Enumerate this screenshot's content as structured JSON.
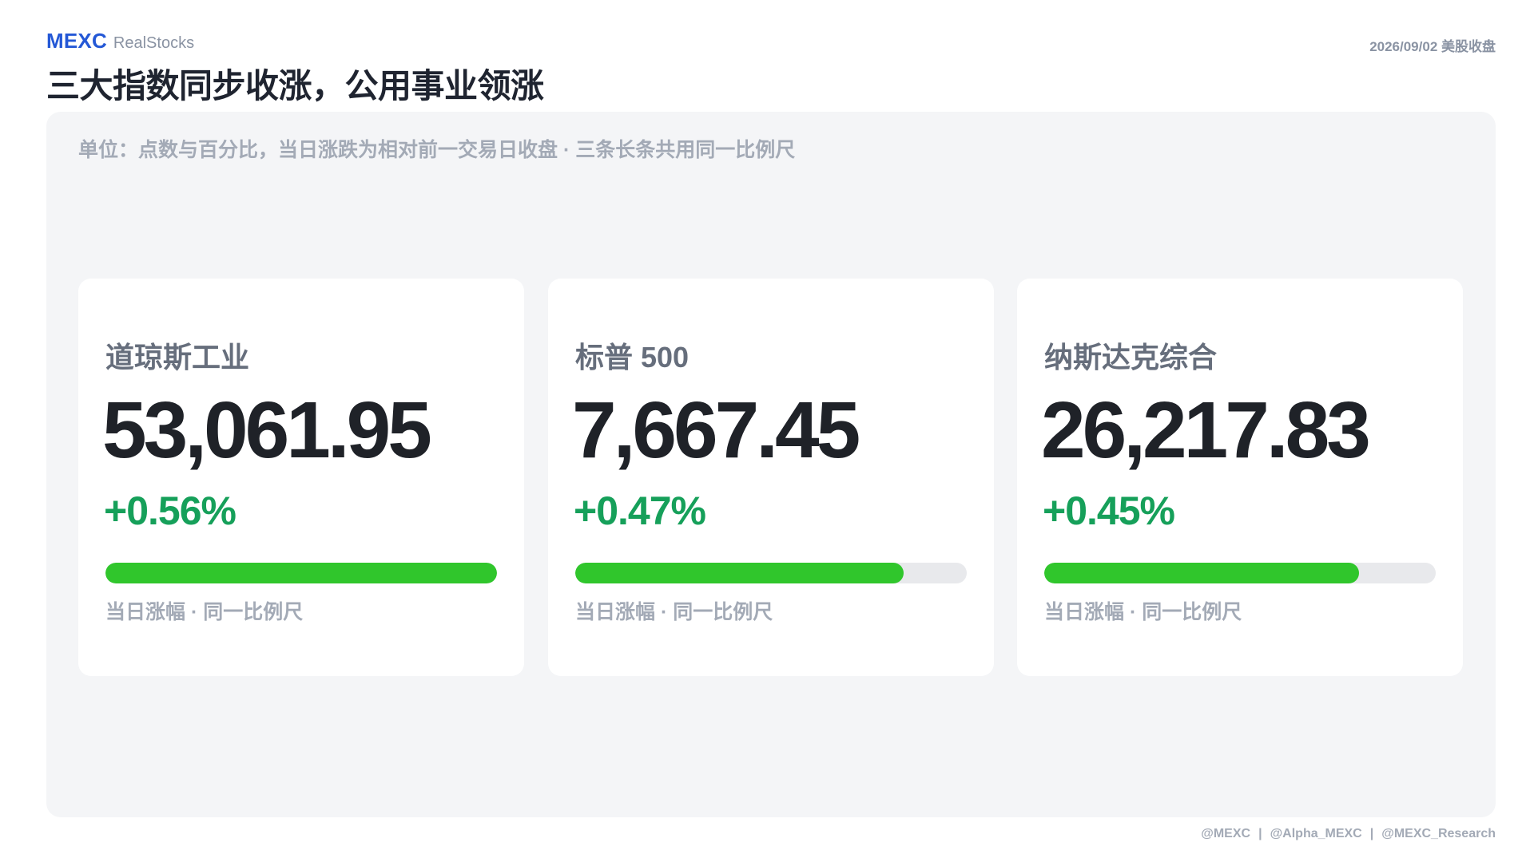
{
  "brand": {
    "name": "MEXC",
    "product": "RealStocks"
  },
  "date_label": "2026/09/02 美股收盘",
  "headline": "三大指数同步收涨，公用事业领涨",
  "panel": {
    "note": "单位：点数与百分比，当日涨跌为相对前一交易日收盘 · 三条长条共用同一比例尺"
  },
  "colors": {
    "brand": "#2458d6",
    "positive": "#16a05a",
    "bar": "#30c62c",
    "bar_track": "#e8e9ec"
  },
  "chart_data": {
    "type": "bar",
    "categories": [
      "道琼斯工业",
      "标普 500",
      "纳斯达克综合"
    ],
    "values": [
      0.56,
      0.47,
      0.45
    ],
    "unit": "%",
    "xlim": [
      0,
      0.56
    ],
    "cards": [
      {
        "name": "道琼斯工业",
        "value": "53,061.95",
        "change": "+0.56%",
        "change_pct": 0.56,
        "caption": "当日涨幅 · 同一比例尺"
      },
      {
        "name": "标普 500",
        "value": "7,667.45",
        "change": "+0.47%",
        "change_pct": 0.47,
        "caption": "当日涨幅 · 同一比例尺"
      },
      {
        "name": "纳斯达克综合",
        "value": "26,217.83",
        "change": "+0.45%",
        "change_pct": 0.45,
        "caption": "当日涨幅 · 同一比例尺"
      }
    ]
  },
  "footer": {
    "handles": [
      "@MEXC",
      "@Alpha_MEXC",
      "@MEXC_Research"
    ],
    "separator": "|"
  }
}
